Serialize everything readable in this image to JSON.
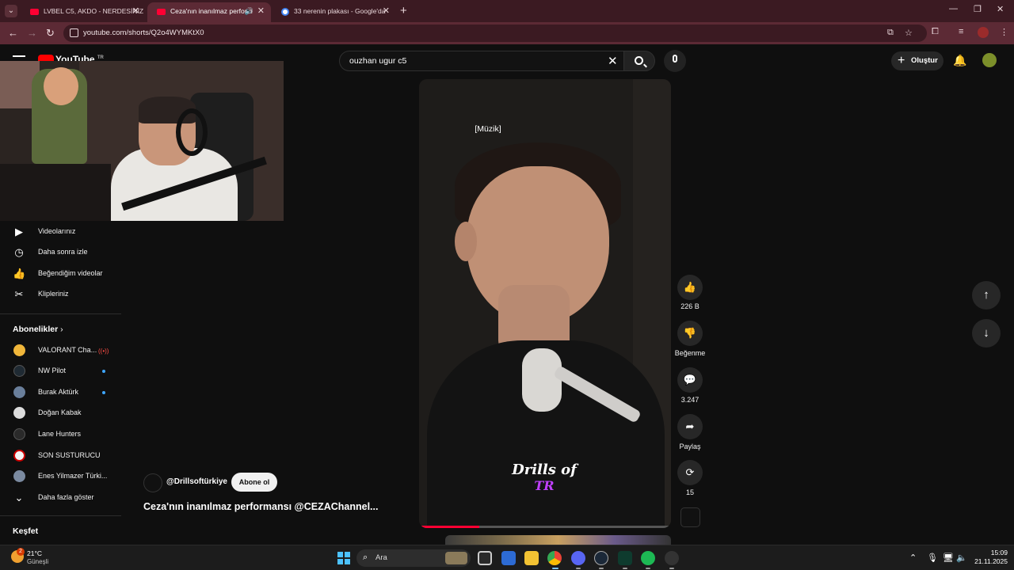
{
  "browser": {
    "tabs": [
      {
        "title": "LVBEL C5, AKDO - NERDESİNİZ",
        "active": false
      },
      {
        "title": "Ceza'nın inanılmaz perform",
        "active": true
      },
      {
        "title": "33 nerenin plakası - Google'da",
        "active": false
      }
    ],
    "url": "youtube.com/shorts/Q2o4WYMKtX0"
  },
  "youtube": {
    "logo_region": "TR",
    "search_value": "ouzhan  ugur c5",
    "create_label": "Oluştur"
  },
  "sidebar": {
    "you_items": [
      {
        "icon": "video-icon",
        "label": "Videolarınız"
      },
      {
        "icon": "clock-icon",
        "label": "Daha sonra izle"
      },
      {
        "icon": "thumbs-up-icon",
        "label": "Beğendiğim videolar"
      },
      {
        "icon": "scissors-icon",
        "label": "Klipleriniz"
      }
    ],
    "subscriptions_title": "Abonelikler",
    "subscriptions": [
      {
        "label": "VALORANT Cha...",
        "color": "#f0b63a",
        "status": "live"
      },
      {
        "label": "NW Pilot",
        "color": "#1f2a33",
        "status": "new"
      },
      {
        "label": "Burak Aktürk",
        "color": "#6a7f9b",
        "status": "new"
      },
      {
        "label": "Doğan Kabak",
        "color": "#dcdcdc",
        "status": ""
      },
      {
        "label": "Lane Hunters",
        "color": "#2a2a2a",
        "status": ""
      },
      {
        "label": "SON SUSTURUCU",
        "color": "#f4f4f4",
        "status": ""
      },
      {
        "label": "Enes Yilmazer Türki...",
        "color": "#7b8aa0",
        "status": ""
      }
    ],
    "show_more": "Daha fazla göster",
    "explore_title": "Keşfet"
  },
  "short": {
    "caption": "[Müzik]",
    "brand_line1": "Drills of",
    "brand_line2": "TR",
    "progress": 0.24,
    "channel": "@Drillsoftürkiye",
    "subscribe_label": "Abone ol",
    "title": "Ceza'nın inanılmaz performansı @CEZAChannel..."
  },
  "actions": {
    "likes": "226 B",
    "dislike_label": "Beğenme",
    "comments": "3.247",
    "share_label": "Paylaş",
    "remix_count": "15"
  },
  "taskbar": {
    "weather_badge": "2",
    "temperature": "21°C",
    "weather_desc": "Güneşli",
    "search_label": "Ara",
    "time": "15:09",
    "date": "21.11.2025"
  }
}
